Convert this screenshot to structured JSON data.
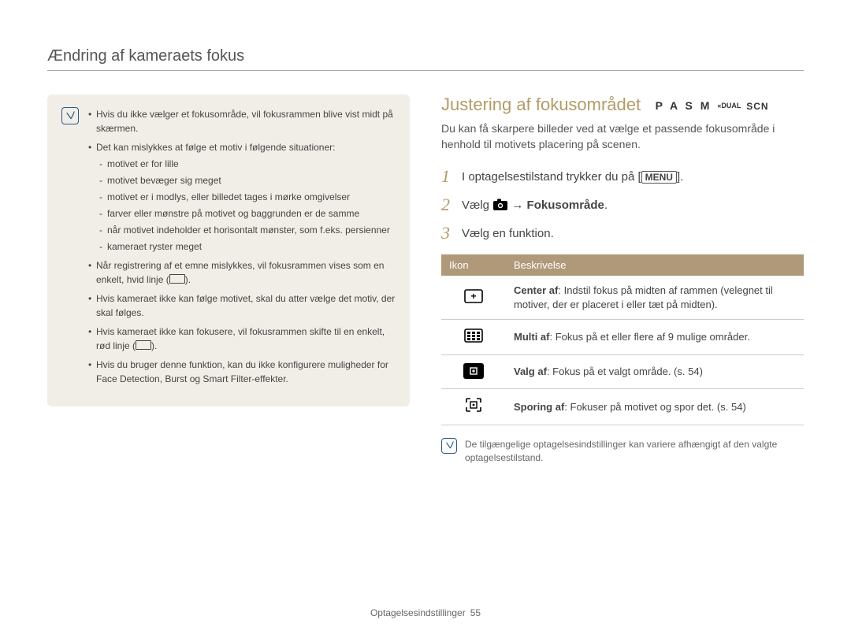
{
  "header": "Ændring af kameraets fokus",
  "info": {
    "bullets": [
      {
        "text": "Hvis du ikke vælger et fokusområde, vil fokusrammen blive vist midt på skærmen."
      },
      {
        "text": "Det kan mislykkes at følge et motiv i følgende situationer:",
        "sub": [
          "motivet er for lille",
          "motivet bevæger sig meget",
          "motivet er i modlys, eller billedet tages i mørke omgivelser",
          "farver eller mønstre på motivet og baggrunden er de samme",
          "når motivet indeholder et horisontalt mønster, som f.eks. persienner",
          "kameraet ryster meget"
        ]
      },
      {
        "text_before": "Når registrering af et emne mislykkes, vil fokusrammen vises som en enkelt, hvid linje (",
        "shape": "rect",
        "text_after": ")."
      },
      {
        "text": "Hvis kameraet ikke kan følge motivet, skal du atter vælge det motiv, der skal følges."
      },
      {
        "text_before": "Hvis kameraet ikke kan fokusere, vil fokusrammen skifte til en enkelt, rød linje (",
        "shape": "rect",
        "text_after": ")."
      },
      {
        "text": "Hvis du bruger denne funktion, kan du ikke konfigurere muligheder for Face Detection, Burst og Smart Filter-effekter."
      }
    ]
  },
  "section": {
    "title": "Justering af fokusområdet",
    "modes": {
      "main": "P A S M",
      "small": "«DUAL",
      "scn": "SCN"
    },
    "description": "Du kan få skarpere billeder ved at vælge et passende fokusområde i henhold til motivets placering på scenen.",
    "steps": [
      {
        "n": "1",
        "pre": "I optagelsestilstand trykker du på [",
        "boxed": "MENU",
        "post": "]."
      },
      {
        "n": "2",
        "pre": "Vælg ",
        "icon": "camera",
        "arrow": " → ",
        "bold": "Fokusområde",
        "post": "."
      },
      {
        "n": "3",
        "pre": "Vælg en funktion."
      }
    ],
    "table": {
      "headers": [
        "Ikon",
        "Beskrivelse"
      ],
      "rows": [
        {
          "icon": "center",
          "term": "Center af",
          "desc": ": Indstil fokus på midten af rammen (velegnet til motiver, der er placeret i eller tæt på midten)."
        },
        {
          "icon": "multi",
          "term": "Multi af",
          "desc": ": Fokus på et eller flere af 9 mulige områder."
        },
        {
          "icon": "select",
          "term": "Valg af",
          "desc": ": Fokus på et valgt område. (s. 54)"
        },
        {
          "icon": "track",
          "term": "Sporing af",
          "desc": ": Fokuser på motivet og spor det. (s. 54)"
        }
      ],
      "note": "De tilgængelige optagelsesindstillinger kan variere afhængigt af den valgte optagelsestilstand."
    }
  },
  "footer": {
    "section": "Optagelsesindstillinger",
    "page": "55"
  }
}
